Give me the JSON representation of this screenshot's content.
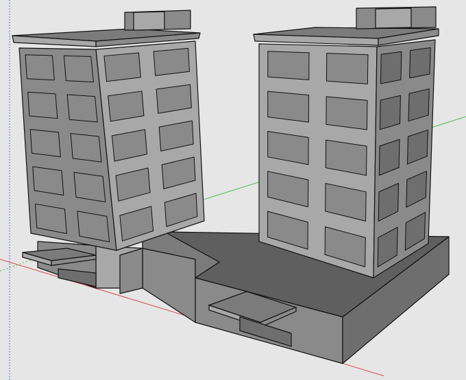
{
  "viewport": {
    "background": "#e6e6e6",
    "axis_colors": {
      "red": "#d9474a",
      "green": "#4dbb4d",
      "blue": "#5a6fd0"
    }
  },
  "model": {
    "face_colors": {
      "light": "#a8a8a8",
      "mid": "#8a8a8a",
      "dark": "#6e6e6e",
      "roof": "#7b7b7b",
      "podium_top": "#5f5f5f",
      "edge": "#111111"
    }
  }
}
